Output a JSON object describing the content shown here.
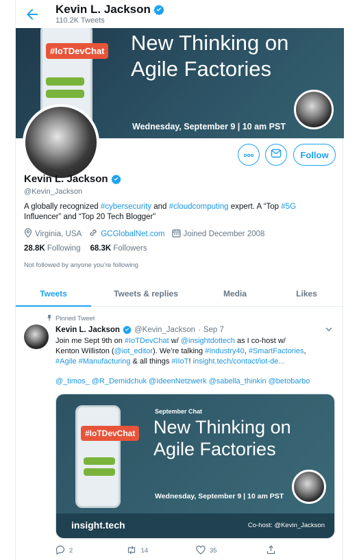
{
  "header": {
    "name": "Kevin L. Jackson",
    "tweet_count": "110.2K Tweets"
  },
  "banner": {
    "tag": "#IoTDevChat",
    "title_line1": "New Thinking on",
    "title_line2": "Agile Factories",
    "date": "Wednesday, September 9 | 10 am PST"
  },
  "profile": {
    "name": "Kevin L. Jackson",
    "handle": "@Kevin_Jackson",
    "bio": {
      "p1": "A globally recognized ",
      "l1": "#cybersecurity",
      "p2": " and ",
      "l2": "#cloudcomputing",
      "p3": " expert. A “Top ",
      "l3": "#5G",
      "p4": " Influencer” and “Top 20 Tech Blogger”"
    },
    "location": "Virginia, USA",
    "website": "GCGlobalNet.com",
    "joined": "Joined December 2008",
    "following_count": "28.8K",
    "following_label": "Following",
    "followers_count": "68.3K",
    "followers_label": "Followers",
    "not_followed": "Not followed by anyone you’re following",
    "follow_label": "Follow"
  },
  "tabs": [
    "Tweets",
    "Tweets & replies",
    "Media",
    "Likes"
  ],
  "tweet": {
    "pinned_label": "Pinned Tweet",
    "name": "Kevin L. Jackson",
    "handle": "@Kevin_Jackson",
    "sep": "·",
    "date": "Sep 7",
    "line1": {
      "t1": "Join me Sept 9th on ",
      "l1": "#IoTDevChat",
      "t2": " w/ ",
      "l2": "@insightdottech",
      "t3": " as I co-host w/"
    },
    "line2": {
      "t1": "Kenton Williston (",
      "l1": "@iot_editor",
      "t2": "). We’re talking ",
      "l2": "#Industry40",
      "t3": ", ",
      "l3": "#SmartFactories",
      "t4": ","
    },
    "line3": {
      "l1": "#Agile",
      "t1": " ",
      "l2": "#Manufacturing",
      "t2": " & all things ",
      "l3": "#IIoT",
      "t3": "! ",
      "l4": "insight.tech/contact/iot-de..."
    },
    "mentions": "@_timos_  @R_Demidchuk @IdeenNetzwerk @sabella_thinkin @betobarbo",
    "card": {
      "subtitle": "September Chat",
      "tag": "#IoTDevChat",
      "title_line1": "New Thinking on",
      "title_line2": "Agile Factories",
      "date": "Wednesday, September 9 | 10 am PST",
      "brand": "insight.tech",
      "cohost": "Co-host: @Kevin_Jackson"
    },
    "replies": "2",
    "retweets": "14",
    "likes": "35"
  },
  "colors": {
    "accent": "#1da1f2",
    "link": "#1b95e0",
    "tag": "#e8543a",
    "bubble": "#7ab33b"
  }
}
